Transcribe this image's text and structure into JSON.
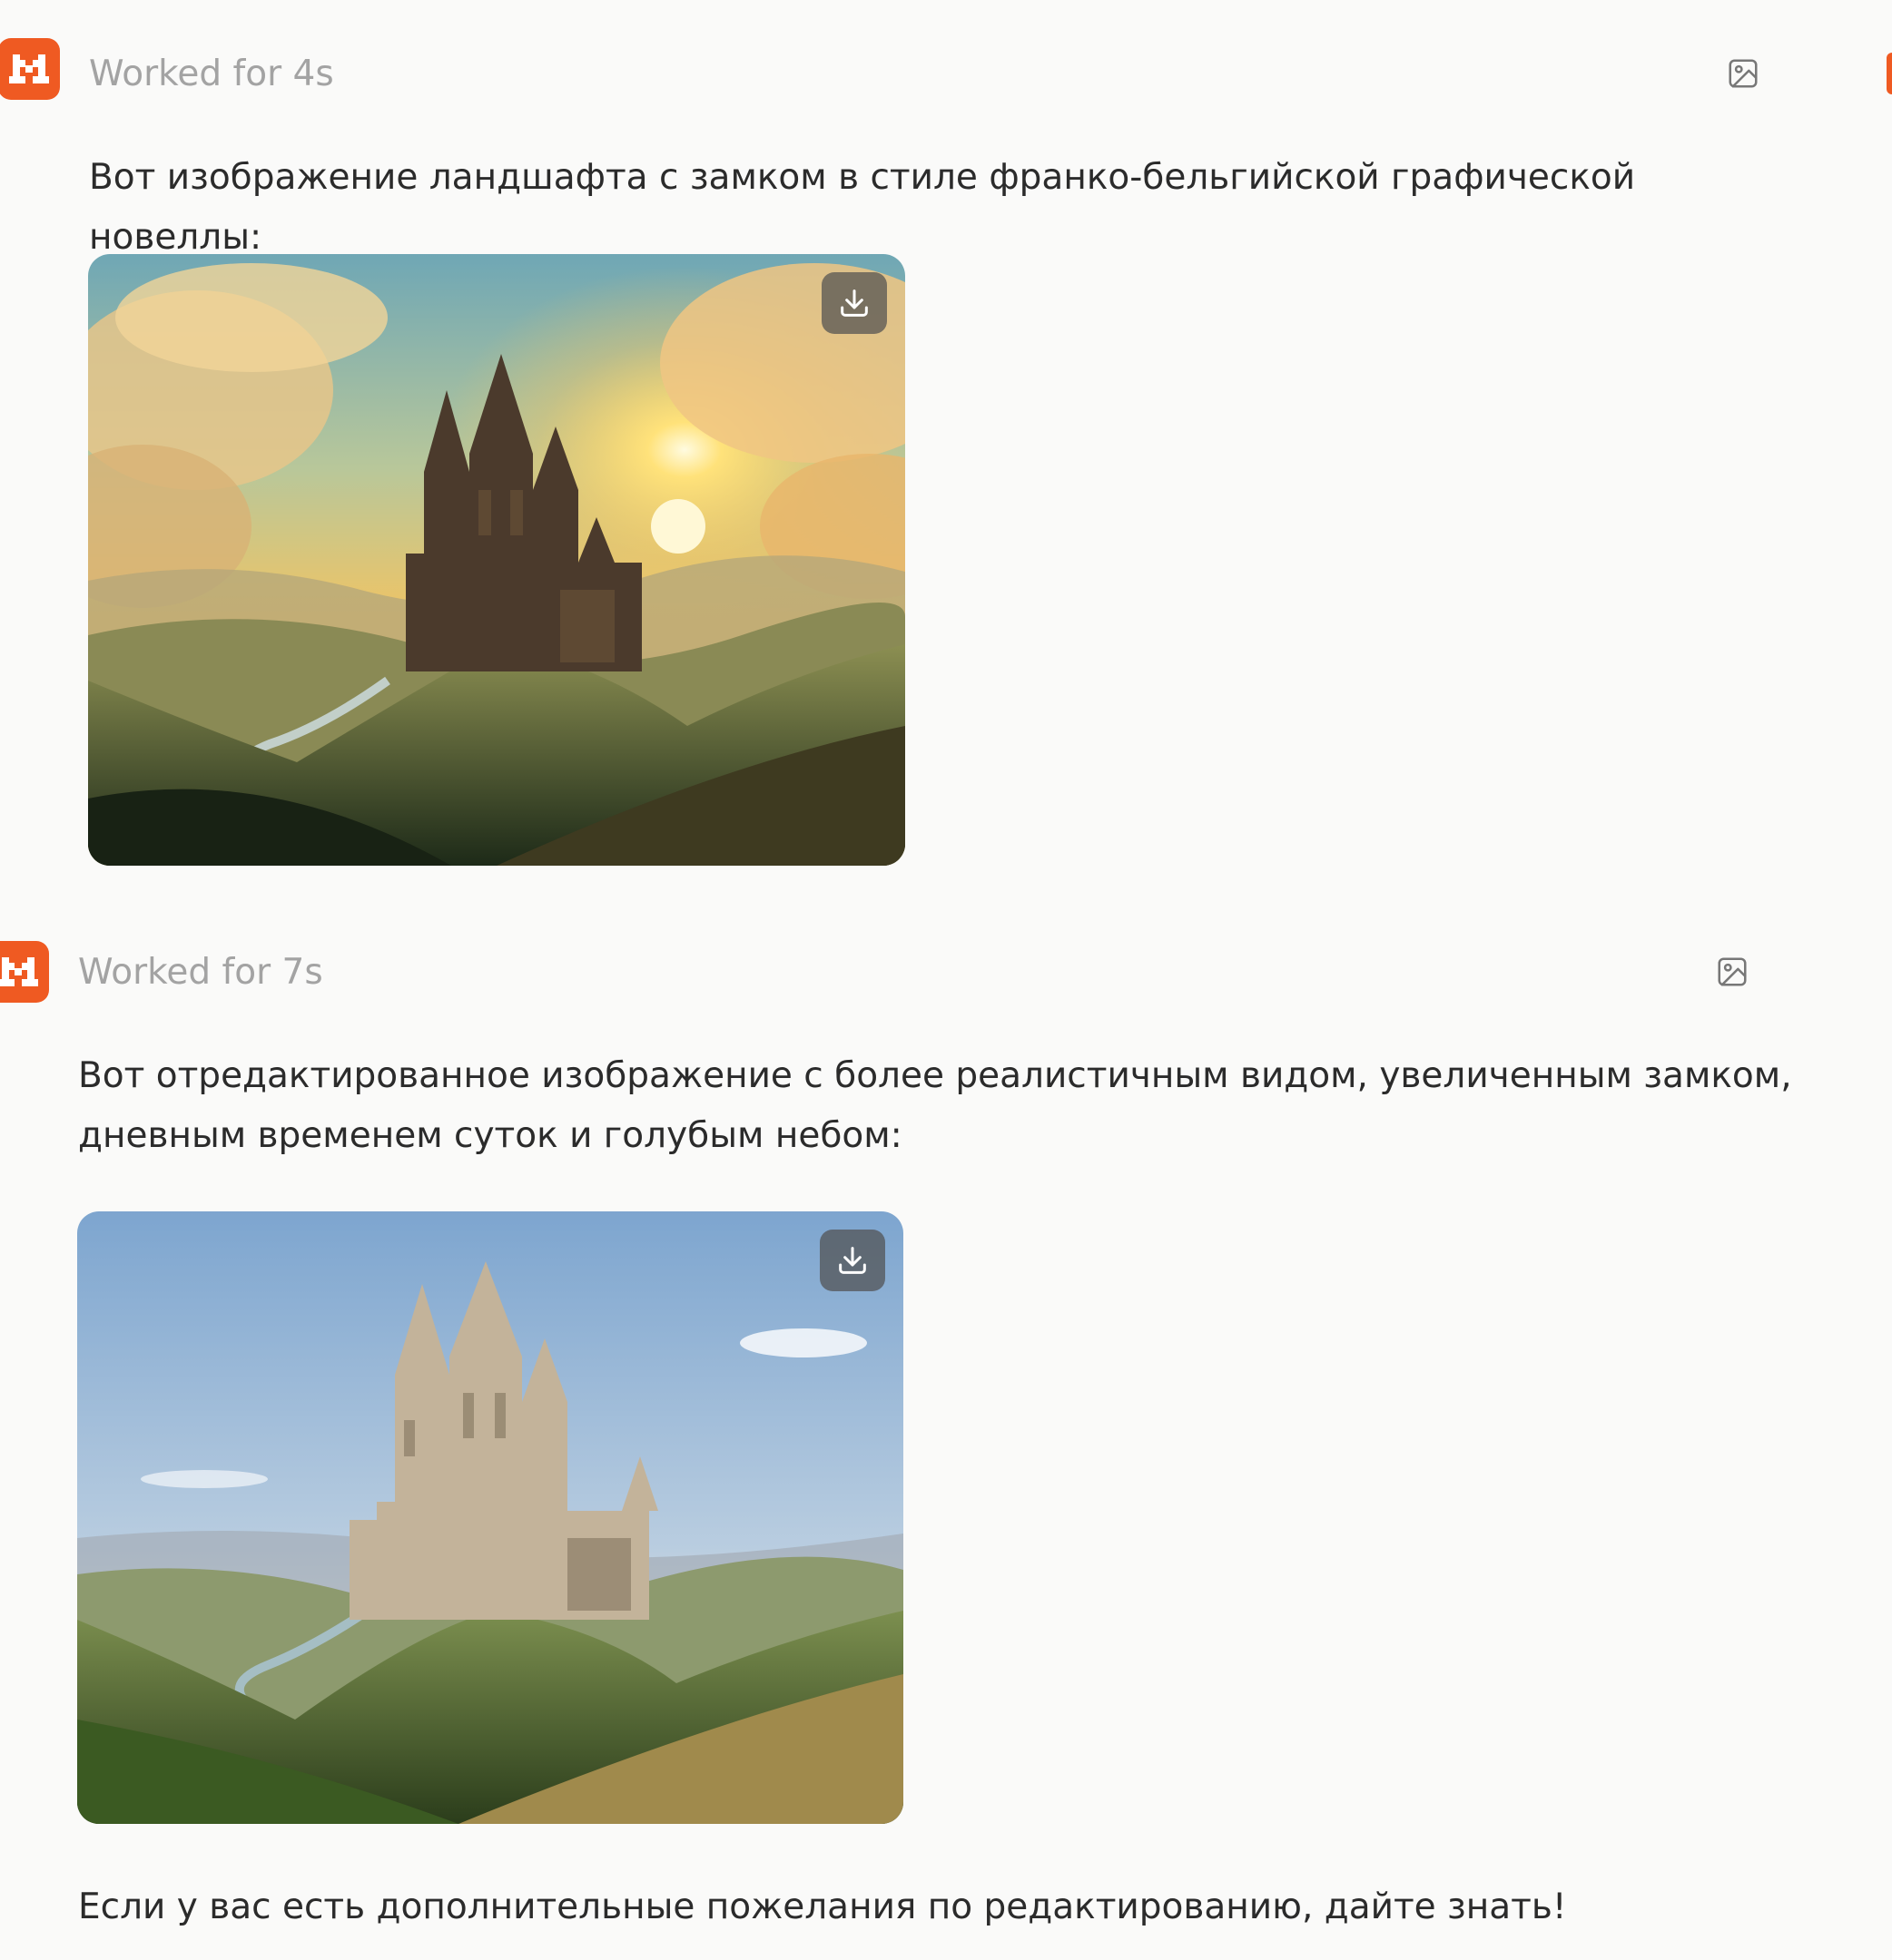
{
  "blocks": [
    {
      "status": "Worked for 4s",
      "avatar_icon": "mistral-m-icon",
      "action_icon": "image-icon",
      "message": "Вот изображение ландшафта с замком в стиле франко-бельгийской графической новеллы:",
      "image": {
        "description_icon": "castle-sunset-illustration",
        "download_icon": "download-icon"
      }
    },
    {
      "status": "Worked for 7s",
      "avatar_icon": "mistral-m-icon",
      "action_icon": "image-icon",
      "message": "Вот отредактированное изображение с более реалистичным видом, увеличенным замком, дневным временем суток и голубым небом:",
      "image": {
        "description_icon": "castle-daytime-photo",
        "download_icon": "download-icon"
      }
    }
  ],
  "footer_message": "Если у вас есть дополнительные пожелания по редактированию, дайте знать!",
  "colors": {
    "accent": "#ef5a22",
    "background": "#fafaf9",
    "status_text": "#a3a3a3",
    "body_text": "#2b2b2b"
  }
}
